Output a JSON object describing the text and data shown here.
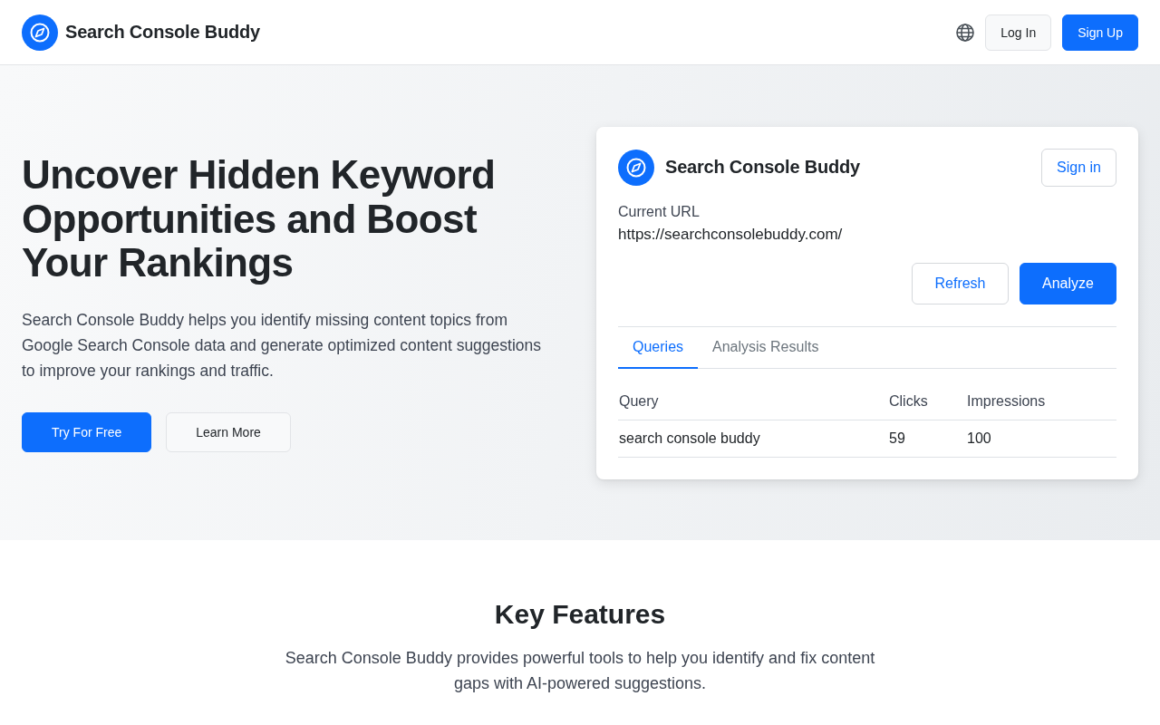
{
  "header": {
    "brand": "Search Console Buddy",
    "actions": [
      {
        "label": "Log In",
        "kind": "secondary"
      },
      {
        "label": "Sign Up",
        "kind": "primary"
      }
    ]
  },
  "hero": {
    "headline": "Uncover Hidden Keyword Opportunities and Boost Your Rankings",
    "description": "Search Console Buddy helps you identify missing content topics from Google Search Console data and generate optimized content suggestions to improve your rankings and traffic.",
    "buttons": [
      {
        "label": "Try For Free",
        "kind": "primary"
      },
      {
        "label": "Learn More",
        "kind": "secondary"
      }
    ]
  },
  "extension_panel": {
    "title": "Search Console Buddy",
    "sign_in": "Sign in",
    "url_label": "Current URL",
    "url": "https://searchconsolebuddy.com/",
    "buttons": [
      {
        "label": "Refresh",
        "kind": "outline"
      },
      {
        "label": "Analyze",
        "kind": "primary"
      }
    ],
    "tabs": [
      {
        "label": "Queries",
        "selected": true
      },
      {
        "label": "Analysis Results",
        "selected": false
      }
    ],
    "table": {
      "columns": [
        "Query",
        "Clicks",
        "Impressions"
      ],
      "rows": [
        [
          "search console buddy",
          "59",
          "100"
        ]
      ]
    }
  },
  "features": {
    "title": "Key Features",
    "description": "Search Console Buddy provides powerful tools to help you identify and fix content gaps with AI-powered suggestions."
  }
}
